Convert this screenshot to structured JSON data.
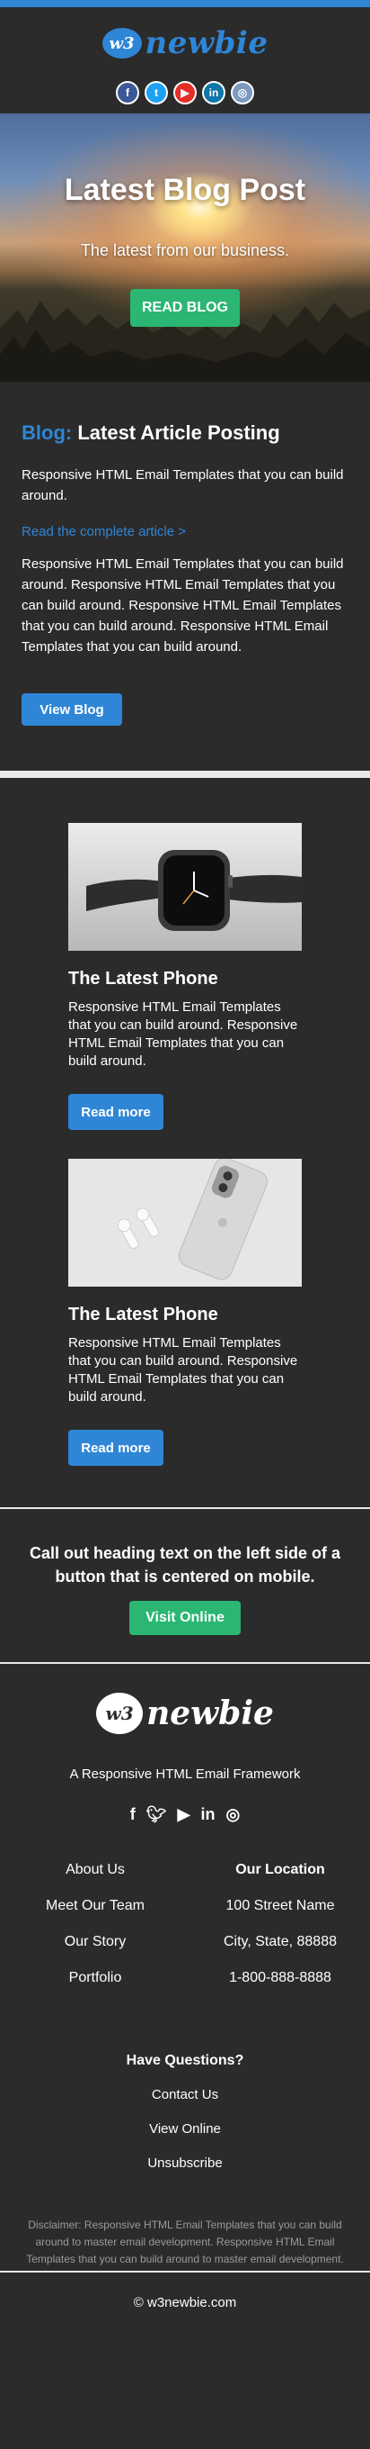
{
  "brand": {
    "badge": "w3",
    "name": "newbie",
    "accent": "#2f86d6",
    "green": "#2bb673"
  },
  "header": {
    "social": [
      "facebook-icon",
      "twitter-icon",
      "youtube-icon",
      "linkedin-icon",
      "instagram-icon"
    ]
  },
  "hero": {
    "title": "Latest Blog Post",
    "subtitle": "The latest from our business.",
    "button": "READ BLOG"
  },
  "blog": {
    "heading_accent": "Blog:",
    "heading": "Latest Article Posting",
    "intro": "Responsive HTML Email Templates that you can build around.",
    "link": "Read the complete article >",
    "body": "Responsive HTML Email Templates that you can build around. Responsive HTML Email Templates that you can build around. Responsive HTML Email Templates that you can build around. Responsive HTML Email Templates that you can build around.",
    "button": "View Blog"
  },
  "products": [
    {
      "title": "The Latest Phone",
      "text": "Responsive HTML Email Templates that you can build around. Responsive HTML Email Templates that you can build around.",
      "button": "Read more"
    },
    {
      "title": "The Latest Phone",
      "text": "Responsive HTML Email Templates that you can build around. Responsive HTML Email Templates that you can build around.",
      "button": "Read more"
    }
  ],
  "callout": {
    "heading": "Call out heading text on the left side of a button that is centered on mobile.",
    "button": "Visit Online"
  },
  "footer": {
    "tagline": "A Responsive HTML Email Framework",
    "social": [
      "facebook-icon",
      "twitter-icon",
      "youtube-icon",
      "linkedin-icon",
      "instagram-icon"
    ],
    "links": [
      "About Us",
      "Meet Our Team",
      "Our Story",
      "Portfolio"
    ],
    "location_heading": "Our Location",
    "location": [
      "100 Street Name",
      "City, State, 88888",
      "1-800-888-8888"
    ],
    "questions_heading": "Have Questions?",
    "questions": [
      "Contact Us",
      "View Online",
      "Unsubscribe"
    ],
    "disclaimer": "Disclaimer: Responsive HTML Email Templates that you can build around to master email development. Responsive HTML Email Templates that you can build around to master email development.",
    "copyright": "© w3newbie.com"
  }
}
